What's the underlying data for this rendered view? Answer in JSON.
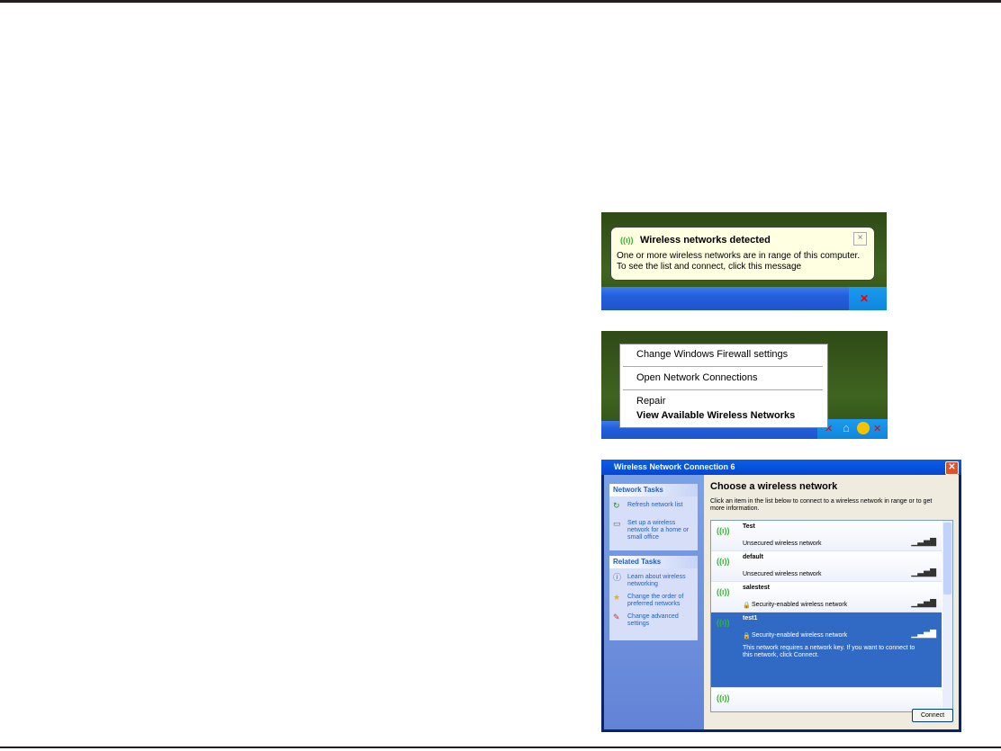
{
  "balloon": {
    "title": "Wireless networks detected",
    "line1": "One or more wireless networks are in range of this computer.",
    "line2": "To see the list and connect, click this message",
    "close": "×"
  },
  "context_menu": {
    "items": [
      "Change Windows Firewall settings",
      "Open Network Connections",
      "Repair",
      "View Available Wireless Networks"
    ]
  },
  "dialog": {
    "title": "Wireless Network Connection 6",
    "network_tasks": {
      "header": "Network Tasks",
      "items": [
        "Refresh network list",
        "Set up a wireless network for a home or small office"
      ]
    },
    "related_tasks": {
      "header": "Related Tasks",
      "items": [
        "Learn about wireless networking",
        "Change the order of preferred networks",
        "Change advanced settings"
      ]
    },
    "heading": "Choose a wireless network",
    "description": "Click an item in the list below to connect to a wireless network in range or to get more information.",
    "networks": [
      {
        "name": "Test",
        "status": "Unsecured wireless network",
        "signal_bars": 2
      },
      {
        "name": "default",
        "status": "Unsecured wireless network",
        "signal_bars": 2
      },
      {
        "name": "salestest",
        "status": "Security-enabled wireless network",
        "signal_bars": 3
      },
      {
        "name": "test1",
        "status": "Security-enabled wireless network",
        "signal_bars": 3,
        "detail": "This network requires a network key. If you want to connect to this network, click Connect.",
        "selected": true
      }
    ],
    "connect": "Connect"
  }
}
